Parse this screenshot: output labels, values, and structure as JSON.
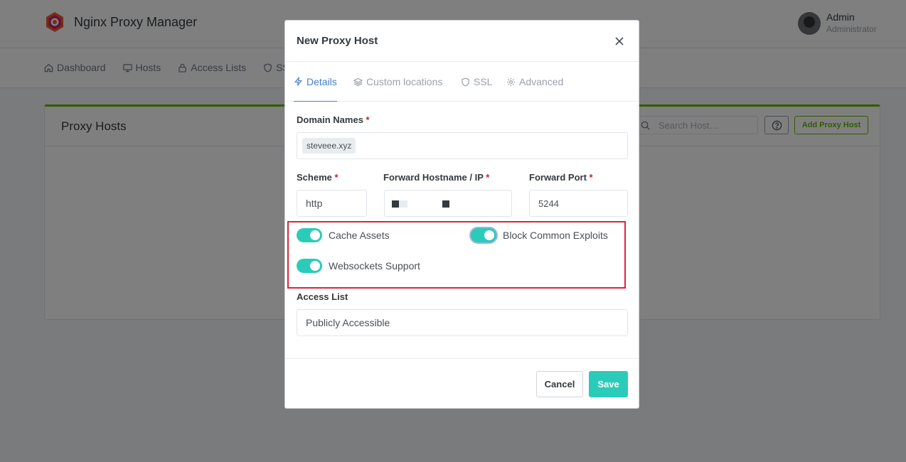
{
  "app": {
    "title": "Nginx Proxy Manager"
  },
  "user": {
    "name": "Admin",
    "role": "Administrator"
  },
  "nav": {
    "items": [
      {
        "label": "Dashboard",
        "icon": "home-icon"
      },
      {
        "label": "Hosts",
        "icon": "monitor-icon"
      },
      {
        "label": "Access Lists",
        "icon": "lock-icon"
      },
      {
        "label": "SSL",
        "icon": "shield-icon"
      }
    ]
  },
  "page": {
    "title": "Proxy Hosts",
    "search_placeholder": "Search Host…",
    "help_label": "?",
    "add_label": "Add Proxy Host"
  },
  "modal": {
    "title": "New Proxy Host",
    "close_label": "×",
    "tabs": [
      {
        "label": "Details",
        "icon": "lightning-icon",
        "active": true
      },
      {
        "label": "Custom locations",
        "icon": "layers-icon",
        "active": false
      },
      {
        "label": "SSL",
        "icon": "shield-icon",
        "active": false
      },
      {
        "label": "Advanced",
        "icon": "gear-icon",
        "active": false
      }
    ],
    "form": {
      "domain_names_label": "Domain Names",
      "domain_names": [
        "steveee.xyz"
      ],
      "scheme_label": "Scheme",
      "scheme_value": "http",
      "forward_host_label": "Forward Hostname / IP",
      "forward_host_value": "",
      "forward_port_label": "Forward Port",
      "forward_port_value": "5244",
      "required_mark": "*",
      "toggles": {
        "cache_assets": {
          "label": "Cache Assets",
          "on": true
        },
        "block_exploits": {
          "label": "Block Common Exploits",
          "on": true
        },
        "websockets": {
          "label": "Websockets Support",
          "on": true
        }
      },
      "access_list_label": "Access List",
      "access_list_value": "Publicly Accessible"
    },
    "cancel_label": "Cancel",
    "save_label": "Save"
  },
  "colors": {
    "accent": "#2bcbba",
    "primary": "#467fcf",
    "success": "#5eba00",
    "highlight": "#d9253a"
  }
}
